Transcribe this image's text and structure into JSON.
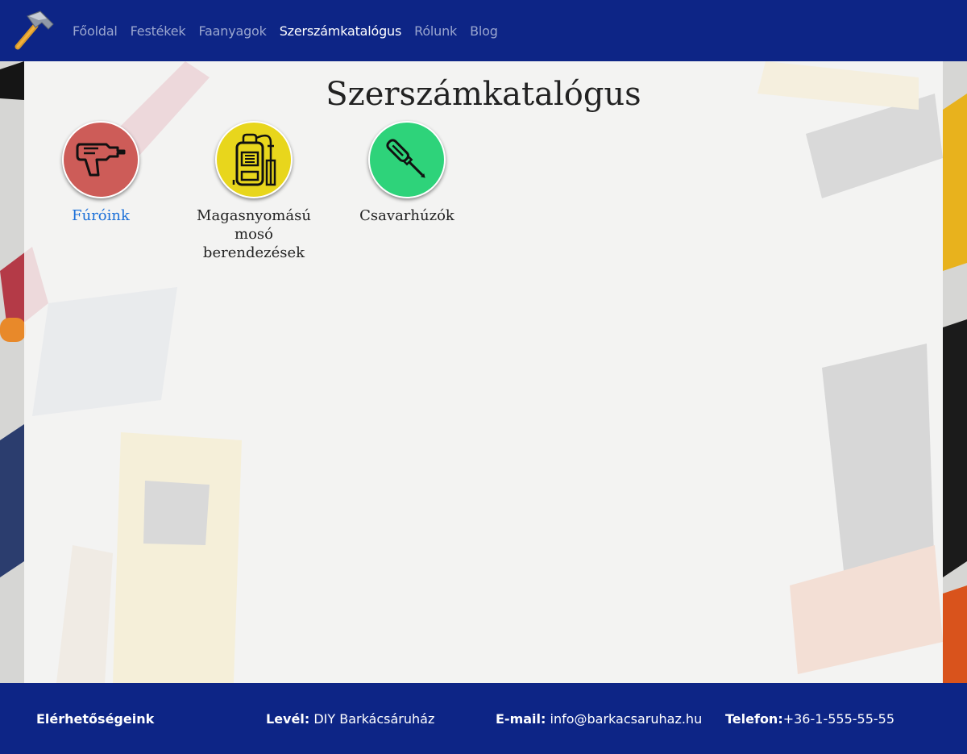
{
  "nav": {
    "logo": "hammer-icon",
    "links": [
      "Főoldal",
      "Festékek",
      "Faanyagok",
      "Szerszámkatalógus",
      "Rólunk",
      "Blog"
    ],
    "active_index": 3
  },
  "main": {
    "title": "Szerszámkatalógus",
    "categories": [
      {
        "label": "Fúróink",
        "icon": "drill-icon",
        "color": "#cd5c58",
        "is_link": true
      },
      {
        "label": "Magasnyomású mosó berendezések",
        "icon": "pressure-washer-icon",
        "color": "#e8d61c",
        "is_link": false
      },
      {
        "label": "Csavarhúzók",
        "icon": "screwdriver-icon",
        "color": "#2ed37a",
        "is_link": false
      }
    ]
  },
  "footer": {
    "heading": "Elérhetőségeink",
    "mail_label": "Levél:",
    "mail_value": "DIY Barkácsáruház",
    "email_label": "E-mail:",
    "email_value": "info@barkacsaruhaz.hu",
    "phone_label": "Telefon:",
    "phone_value": "+36-1-555-55-55"
  },
  "colors": {
    "nav_bg": "#0d2586",
    "footer_bg": "#0d2586",
    "link": "#1a6fd8"
  }
}
